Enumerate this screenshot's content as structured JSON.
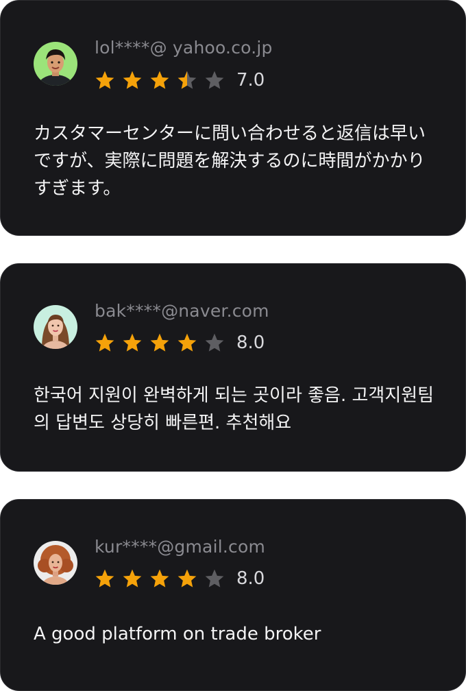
{
  "colors": {
    "card_bg": "#18181b",
    "star_filled": "#f5a20a",
    "star_empty": "#5e5e62",
    "email_text": "#8a8a90",
    "review_text": "#f4f4f5"
  },
  "reviews": [
    {
      "email": "lol****@ yahoo.co.jp",
      "rating": 3.5,
      "score": "7.0",
      "avatar_icon": "user-avatar-icon",
      "text": "カスタマーセンターに問い合わせると返信は早いですが、実際に問題を解決するのに時間がかかりすぎます。"
    },
    {
      "email": "bak****@naver.com",
      "rating": 4,
      "score": "8.0",
      "avatar_icon": "user-avatar-icon",
      "text": "한국어 지원이 완벽하게 되는 곳이라 좋음. 고객지원팀의 답변도 상당히 빠른편. 추천해요"
    },
    {
      "email": "kur****@gmail.com",
      "rating": 4,
      "score": "8.0",
      "avatar_icon": "user-avatar-icon",
      "text": "A good platform on trade broker"
    }
  ]
}
